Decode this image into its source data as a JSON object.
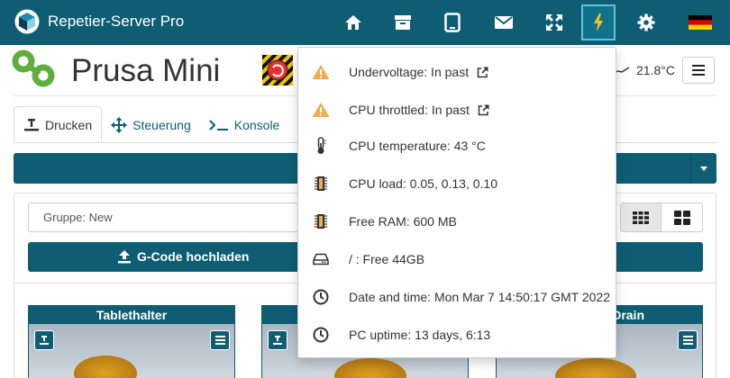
{
  "app": {
    "name": "Repetier-Server Pro"
  },
  "printer": {
    "name": "Prusa Mini",
    "temperature": "21.8°C"
  },
  "tabs": [
    {
      "label": "Drucken"
    },
    {
      "label": "Steuerung"
    },
    {
      "label": "Konsole"
    }
  ],
  "group": {
    "value": "Gruppe: New"
  },
  "upload": {
    "label": "G-Code hochladen"
  },
  "cards": [
    {
      "title": "Tablethalter"
    },
    {
      "title": ""
    },
    {
      "title": "Drain"
    }
  ],
  "system_info": {
    "undervoltage": "Undervoltage: In past",
    "cpu_throttled": "CPU throttled: In past",
    "cpu_temperature": "CPU temperature: 43 °C",
    "cpu_load": "CPU load: 0.05, 0.13, 0.10",
    "free_ram": "Free RAM: 600 MB",
    "disk": "/ : Free 44GB",
    "datetime": "Date and time: Mon Mar 7 14:50:17 GMT 2022",
    "uptime": "PC uptime: 13 days, 6:13"
  },
  "colors": {
    "primary": "#0e5d73",
    "accent": "#5fc3dd",
    "warning": "#f0ad4e",
    "bolt": "#f5c518"
  },
  "icons": {
    "nav": [
      "home-icon",
      "archive-icon",
      "tablet-icon",
      "envelope-icon",
      "fullscreen-icon",
      "bolt-icon",
      "gear-icon",
      "german-flag-icon"
    ]
  }
}
